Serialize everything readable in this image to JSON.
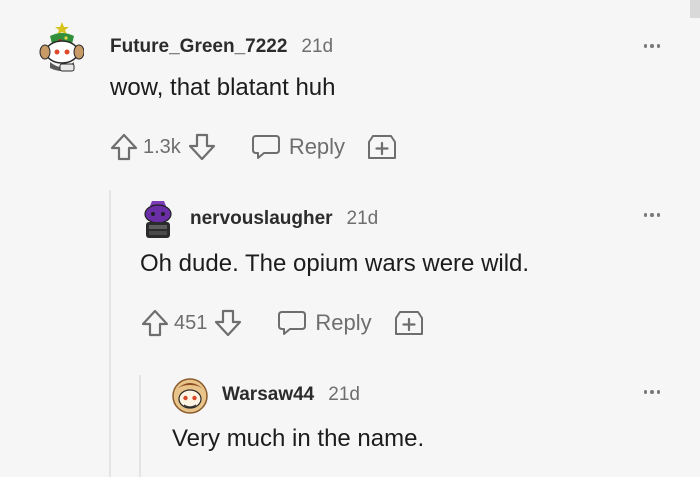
{
  "comments": [
    {
      "username": "Future_Green_7222",
      "time": "21d",
      "text": "wow, that blatant huh",
      "votes": "1.3k",
      "reply_label": "Reply",
      "avatar": "snoo-avatar-green"
    },
    {
      "username": "nervouslaugher",
      "time": "21d",
      "text": "Oh dude. The opium wars were wild.",
      "votes": "451",
      "reply_label": "Reply",
      "avatar": "snoo-avatar-purple"
    },
    {
      "username": "Warsaw44",
      "time": "21d",
      "text": "Very much in the name.",
      "avatar": "snoo-avatar-orange"
    }
  ],
  "colors": {
    "background": "#f6f6f6",
    "text": "#1c1c1c",
    "muted": "#6e6e6e",
    "thread_line": "#e4e4e4"
  },
  "icons": [
    "upvote-icon",
    "downvote-icon",
    "reply-bubble-icon",
    "award-plus-icon",
    "more-options-icon"
  ]
}
